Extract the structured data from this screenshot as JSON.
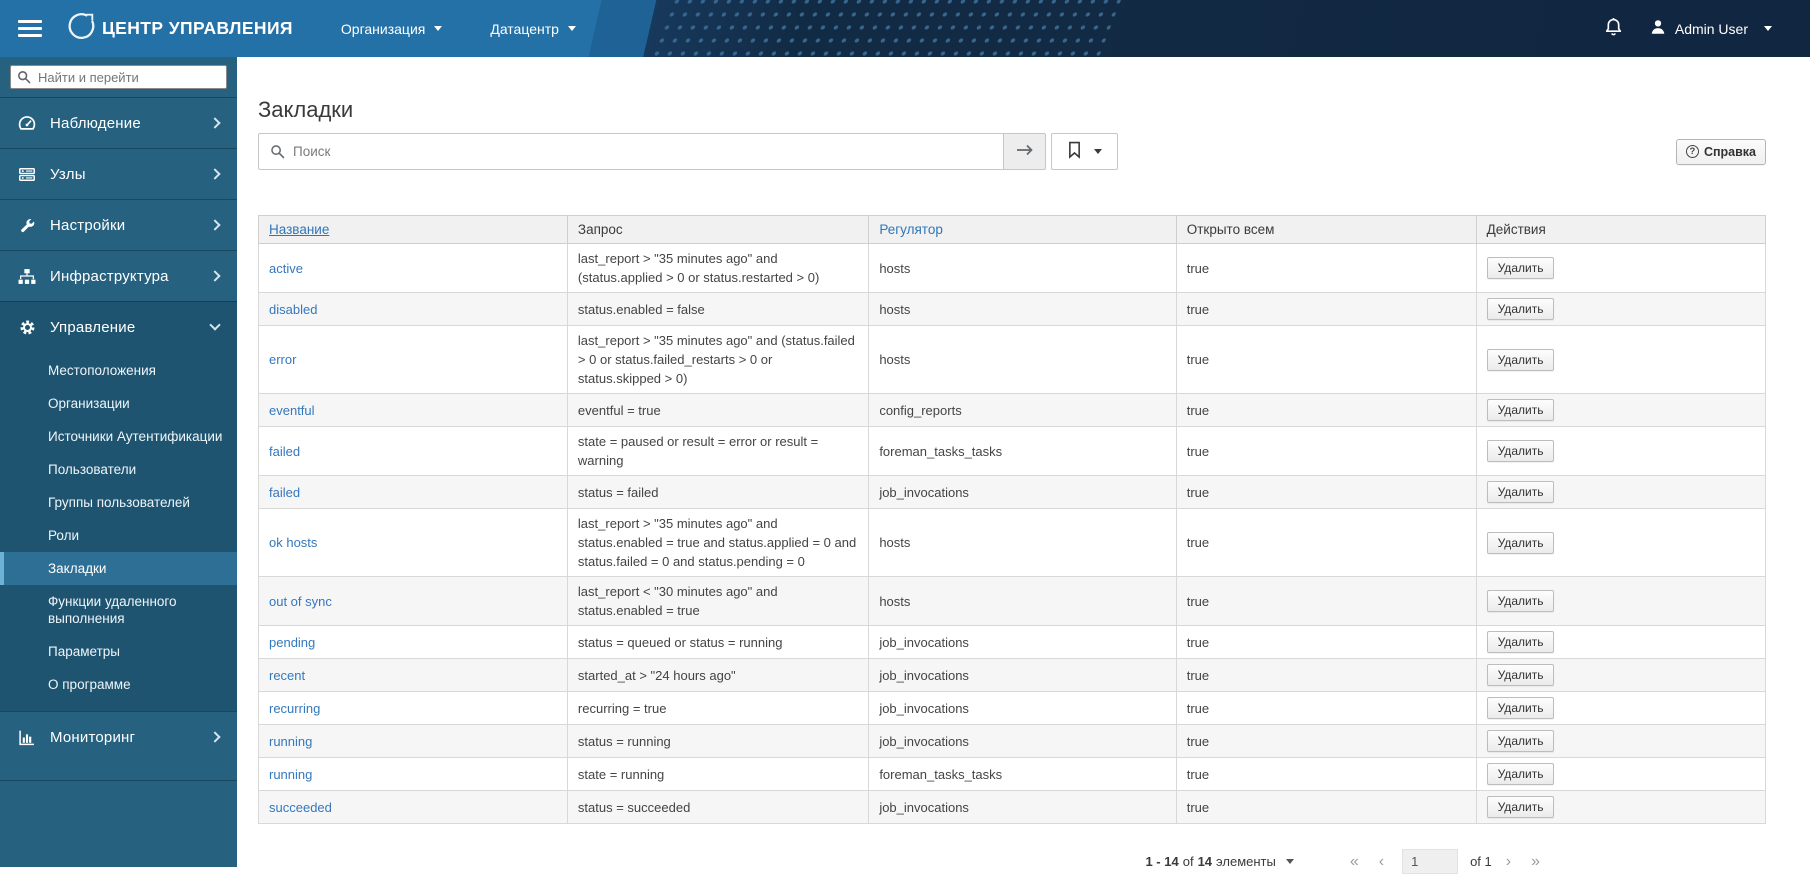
{
  "navbar": {
    "brand": "ЦЕНТР УПРАВЛЕНИЯ",
    "context_menus": [
      {
        "label": "Организация",
        "icon": "chevron-down"
      },
      {
        "label": "Датацентр",
        "icon": "chevron-down"
      }
    ],
    "bell_icon": "bell",
    "user": {
      "label": "Admin User",
      "icon": "user"
    }
  },
  "sidebar": {
    "search_placeholder": "Найти и перейти",
    "search_icon": "search",
    "items": [
      {
        "id": "monitor",
        "label": "Наблюдение",
        "icon": "gauge"
      },
      {
        "id": "hosts",
        "label": "Узлы",
        "icon": "server"
      },
      {
        "id": "settings",
        "label": "Настройки",
        "icon": "wrench"
      },
      {
        "id": "infrastructure",
        "label": "Инфраструктура",
        "icon": "sitemap"
      },
      {
        "id": "administer",
        "label": "Управление",
        "icon": "gear",
        "expanded": true,
        "children": [
          {
            "label": "Местоположения"
          },
          {
            "label": "Организации"
          },
          {
            "label": "Источники Аутентификации"
          },
          {
            "label": "Пользователи"
          },
          {
            "label": "Группы пользователей"
          },
          {
            "label": "Роли"
          },
          {
            "label": "Закладки",
            "selected": true
          },
          {
            "label": "Функции удаленного выполнения"
          },
          {
            "label": "Параметры"
          },
          {
            "label": "О программе"
          }
        ]
      },
      {
        "id": "monitoring",
        "label": "Мониторинг",
        "icon": "chart"
      }
    ]
  },
  "main": {
    "title": "Закладки",
    "toolbar": {
      "search_placeholder": "Поиск",
      "search_icon": "search",
      "submit_icon": "arrow-right",
      "bookmark_icon": "bookmark",
      "help_icon": "?",
      "help_label": "Справка"
    },
    "table": {
      "headers": [
        {
          "label": "Название",
          "sortable": true
        },
        {
          "label": "Запрос",
          "sortable": false
        },
        {
          "label": "Регулятор",
          "sortable": true
        },
        {
          "label": "Открыто всем",
          "sortable": false
        },
        {
          "label": "Действия",
          "sortable": false
        }
      ],
      "delete_label": "Удалить",
      "rows": [
        {
          "name": "active",
          "query": "last_report > \"35 minutes ago\" and (status.applied > 0 or status.restarted > 0)",
          "controller": "hosts",
          "public": "true"
        },
        {
          "name": "disabled",
          "query": "status.enabled = false",
          "controller": "hosts",
          "public": "true"
        },
        {
          "name": "error",
          "query": "last_report > \"35 minutes ago\" and (status.failed > 0 or status.failed_restarts > 0 or status.skipped > 0)",
          "controller": "hosts",
          "public": "true"
        },
        {
          "name": "eventful",
          "query": "eventful = true",
          "controller": "config_reports",
          "public": "true"
        },
        {
          "name": "failed",
          "query": "state = paused or result = error or result = warning",
          "controller": "foreman_tasks_tasks",
          "public": "true"
        },
        {
          "name": "failed",
          "query": "status = failed",
          "controller": "job_invocations",
          "public": "true"
        },
        {
          "name": "ok hosts",
          "query": "last_report > \"35 minutes ago\" and status.enabled = true and status.applied = 0 and status.failed = 0 and status.pending = 0",
          "controller": "hosts",
          "public": "true"
        },
        {
          "name": "out of sync",
          "query": "last_report < \"30 minutes ago\" and status.enabled = true",
          "controller": "hosts",
          "public": "true"
        },
        {
          "name": "pending",
          "query": "status = queued or status = running",
          "controller": "job_invocations",
          "public": "true"
        },
        {
          "name": "recent",
          "query": "started_at > \"24 hours ago\"",
          "controller": "job_invocations",
          "public": "true"
        },
        {
          "name": "recurring",
          "query": "recurring = true",
          "controller": "job_invocations",
          "public": "true"
        },
        {
          "name": "running",
          "query": "status = running",
          "controller": "job_invocations",
          "public": "true"
        },
        {
          "name": "running",
          "query": "state = running",
          "controller": "foreman_tasks_tasks",
          "public": "true"
        },
        {
          "name": "succeeded",
          "query": "status = succeeded",
          "controller": "job_invocations",
          "public": "true"
        }
      ]
    },
    "pagination": {
      "range": "1 - 14",
      "of_label": "of",
      "total": "14",
      "items_label": "элементы",
      "page": "1",
      "pages_label": "of 1",
      "first_icon": "«",
      "prev_icon": "‹",
      "next_icon": "›",
      "last_icon": "»"
    }
  },
  "colors": {
    "navbar_left": "#2471a7",
    "navbar_right": "#112640",
    "sidebar_bg": "#266180",
    "selected_accent": "#6cb2d4",
    "link": "#3478bd"
  }
}
